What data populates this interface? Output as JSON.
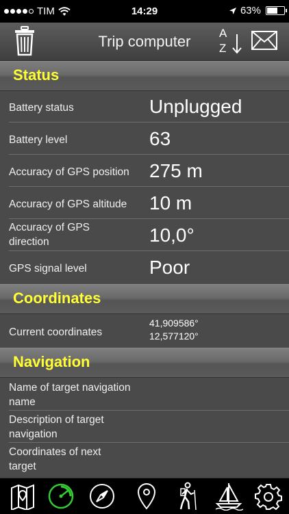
{
  "statusbar": {
    "carrier": "TIM",
    "time": "14:29",
    "battery_percent": "63%",
    "battery_level": 0.63,
    "signal_bars": 4
  },
  "navbar": {
    "title": "Trip computer",
    "sort_top": "A",
    "sort_bottom": "Z",
    "icons": [
      "trash-icon",
      "sort-az-icon",
      "mail-icon"
    ]
  },
  "colors": {
    "section_title": "#ffff33",
    "background": "#4a4a4a",
    "active_tab": "#33cc33"
  },
  "sections": {
    "status": {
      "title": "Status",
      "rows": [
        {
          "label": "Battery status",
          "value": "Unplugged"
        },
        {
          "label": "Battery level",
          "value": "63"
        },
        {
          "label": "Accuracy of GPS position",
          "value": "275 m"
        },
        {
          "label": "Accuracy of GPS altitude",
          "value": "10 m"
        },
        {
          "label": "Accuracy of GPS direction",
          "value": "10,0°"
        },
        {
          "label": "GPS signal level",
          "value": "Poor"
        }
      ]
    },
    "coordinates": {
      "title": "Coordinates",
      "rows": [
        {
          "label": "Current coordinates",
          "value_line1": "41,909586°",
          "value_line2": "12,577120°"
        }
      ]
    },
    "navigation": {
      "title": "Navigation",
      "rows": [
        {
          "label": "Name of target navigation name",
          "value": ""
        },
        {
          "label": "Description of target navigation",
          "value": ""
        },
        {
          "label": "Coordinates of next target",
          "value": ""
        }
      ]
    }
  },
  "tabbar": {
    "tabs": [
      "map-icon",
      "trip-computer-icon",
      "compass-icon",
      "location-pin-icon",
      "hiker-icon",
      "sailboat-icon",
      "settings-gear-icon"
    ],
    "active": "trip-computer-icon"
  }
}
